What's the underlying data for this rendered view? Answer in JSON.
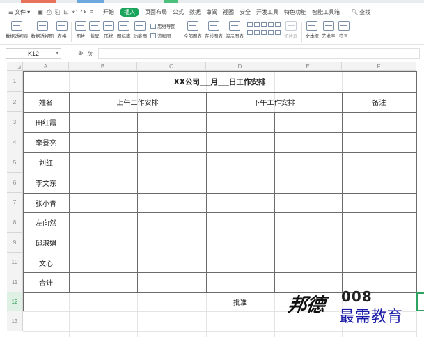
{
  "app": {
    "menu": {
      "file": "文件",
      "tabs": [
        "开始",
        "插入",
        "页面布局",
        "公式",
        "数据",
        "审阅",
        "视图",
        "安全",
        "开发工具",
        "特色功能",
        "智能工具箱"
      ],
      "active_tab": "插入",
      "search": "查找"
    },
    "ribbon": {
      "buttons": [
        {
          "label": "数据透视表"
        },
        {
          "label": "数据透视图"
        },
        {
          "label": "表格"
        },
        {
          "label": "图片"
        },
        {
          "label": "截屏"
        },
        {
          "label": "形状"
        },
        {
          "label": "图标库"
        },
        {
          "label": "功能图"
        },
        {
          "stacked": [
            "思维导图",
            "流程图"
          ]
        },
        {
          "label": "全部图表"
        },
        {
          "label": "在线图表"
        },
        {
          "label": "演示图表"
        },
        {
          "label": "切片器"
        },
        {
          "label": "文本框"
        },
        {
          "label": "艺术字"
        },
        {
          "label": "符号"
        }
      ]
    },
    "formula_bar": {
      "cell_ref": "K12",
      "fx": "fx",
      "content": ""
    },
    "accent_color": "#1aa35a"
  },
  "sheet": {
    "columns": [
      "A",
      "B",
      "C",
      "D",
      "E",
      "F"
    ],
    "rows": [
      "1",
      "2",
      "3",
      "4",
      "5",
      "6",
      "7",
      "8",
      "9",
      "10",
      "11",
      "12",
      "13"
    ],
    "selected_row": "12",
    "title": "XX公司___月___日工作安排",
    "headers": {
      "name": "姓名",
      "morning": "上午工作安排",
      "afternoon": "下午工作安排",
      "notes": "备注"
    },
    "names": [
      "田红霞",
      "李景亮",
      "刘红",
      "李文东",
      "张小青",
      "左向然",
      "邱淑娟",
      "文心",
      "合计"
    ],
    "approve_label": "批准"
  },
  "watermark": {
    "brand": "邦德",
    "number": "008",
    "tagline": "最需教育"
  }
}
